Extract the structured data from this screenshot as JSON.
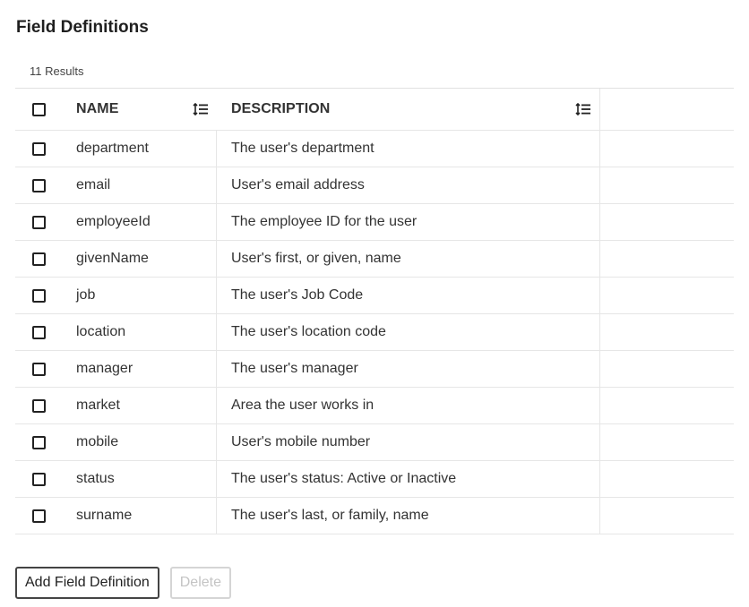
{
  "page": {
    "title": "Field Definitions",
    "result_count": "11 Results"
  },
  "table": {
    "columns": {
      "name": "NAME",
      "description": "DESCRIPTION"
    },
    "rows": [
      {
        "name": "department",
        "description": "The user's department"
      },
      {
        "name": "email",
        "description": "User's email address"
      },
      {
        "name": "employeeId",
        "description": "The employee ID for the user"
      },
      {
        "name": "givenName",
        "description": "User's first, or given, name"
      },
      {
        "name": "job",
        "description": "The user's Job Code"
      },
      {
        "name": "location",
        "description": "The user's location code"
      },
      {
        "name": "manager",
        "description": "The user's manager"
      },
      {
        "name": "market",
        "description": "Area the user works in"
      },
      {
        "name": "mobile",
        "description": "User's mobile number"
      },
      {
        "name": "status",
        "description": "The user's status: Active or Inactive"
      },
      {
        "name": "surname",
        "description": "The user's last, or family, name"
      }
    ]
  },
  "actions": {
    "add_label": "Add Field Definition",
    "delete_label": "Delete"
  },
  "icons": {
    "sort": "sort-order-icon",
    "checkbox": "checkbox-empty"
  }
}
